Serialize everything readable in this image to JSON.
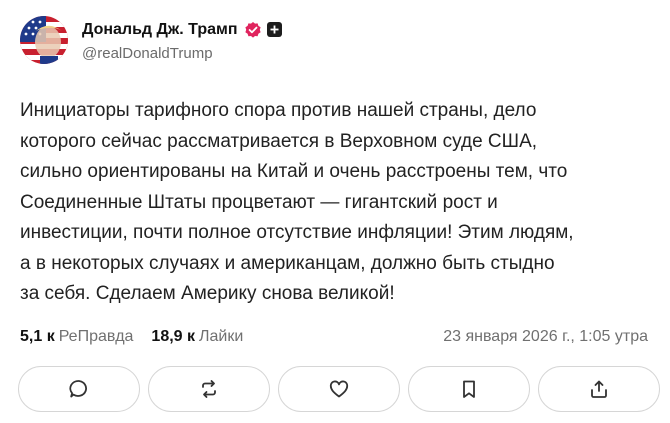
{
  "author": {
    "display_name": "Дональд Дж. Трамп",
    "handle": "@realDonaldTrump"
  },
  "post": {
    "text": "Инициаторы тарифного спора против нашей страны, дело\nкоторого сейчас рассматривается в Верховном суде США,\nсильно ориентированы на Китай и очень расстроены тем, что\nСоединенные Штаты процветают — гигантский рост и\nинвестиции, почти полное отсутствие инфляции! Этим людям,\nа в некоторых случаях и американцам, должно быть стыдно\nза себя. Сделаем Америку снова великой!",
    "retruths_count": "5,1 к",
    "retruths_label": "РеПравда",
    "likes_count": "18,9 к",
    "likes_label": "Лайки",
    "timestamp": "23 января 2026 г., 1:05 утра"
  },
  "actions": [
    "comment-icon",
    "retruth-icon",
    "like-icon",
    "bookmark-icon",
    "share-icon"
  ],
  "colors": {
    "verified_badge": "#e0245e",
    "muted_text": "#707070",
    "border": "#d6d6d6"
  }
}
